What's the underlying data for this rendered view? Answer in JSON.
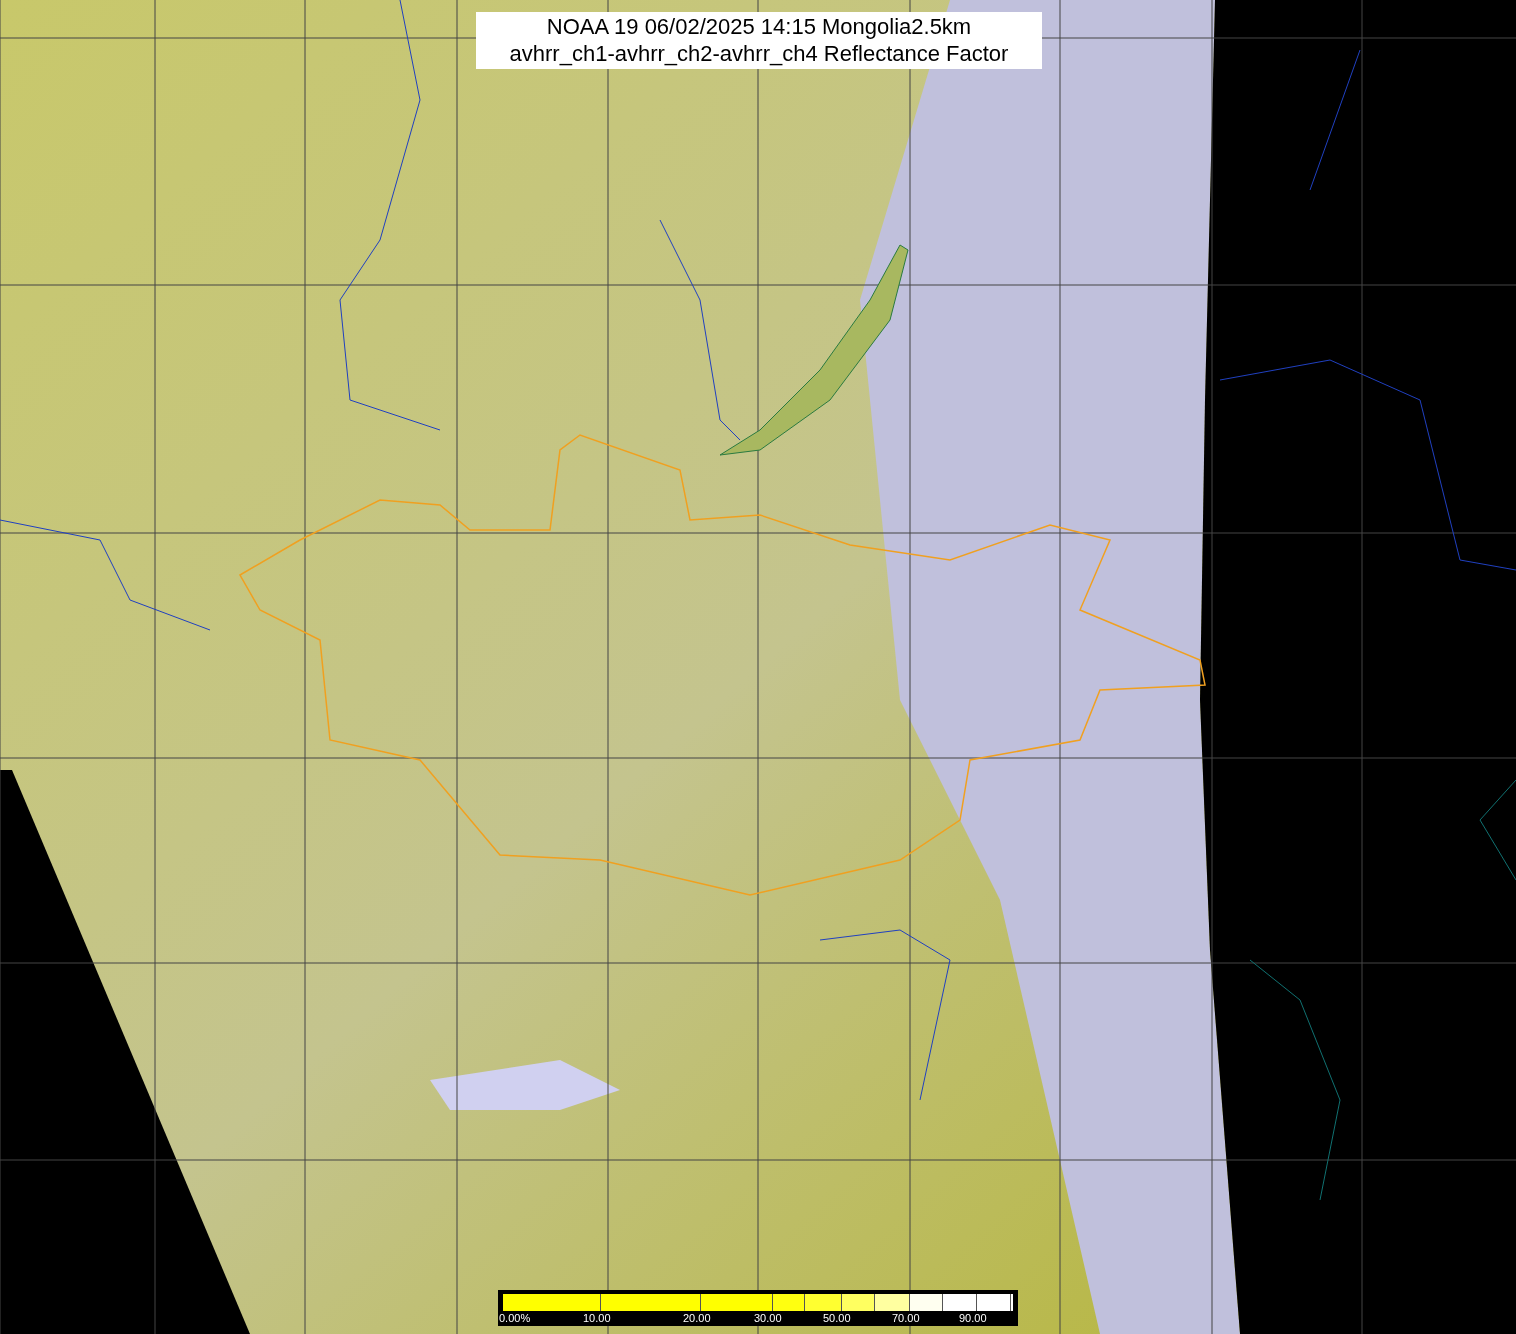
{
  "title": {
    "lines": [
      "NOAA 19 06/02/2025 14:15 Mongolia2.5km",
      "avhrr_ch1-avhrr_ch2-avhrr_ch4 Reflectance Factor"
    ]
  },
  "colorbar": {
    "segments": [
      {
        "color": "#ffff00"
      },
      {
        "color": "#ffff00"
      },
      {
        "color": "#ffff00"
      },
      {
        "color": "#ffff10"
      },
      {
        "color": "#ffff30"
      },
      {
        "color": "#ffff60"
      },
      {
        "color": "#ffffa0"
      },
      {
        "color": "#fffff0"
      },
      {
        "color": "#ffffff"
      },
      {
        "color": "#ffffff"
      }
    ],
    "labels": [
      "0.00%",
      "10.00",
      "20.00",
      "30.00",
      "50.00",
      "70.00",
      "90.00"
    ]
  }
}
